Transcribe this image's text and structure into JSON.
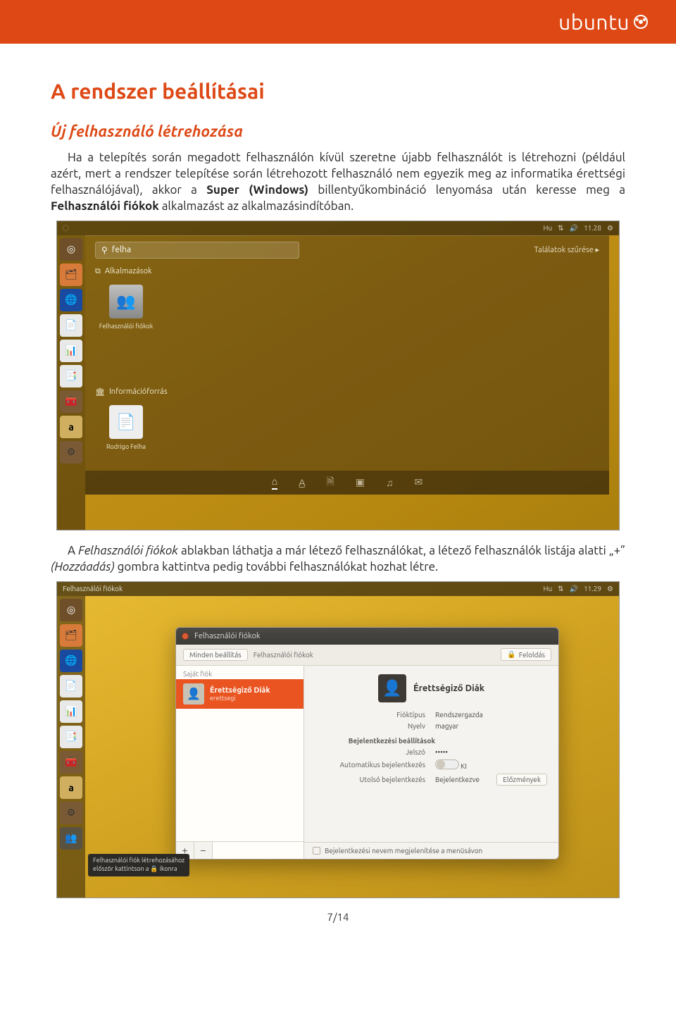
{
  "header": {
    "brand": "ubuntu"
  },
  "section_title": "A rendszer beállításai",
  "subsection_title": "Új felhasználó létrehozása",
  "para1_a": "Ha a telepítés során megadott felhasználón kívül szeretne újabb felhasználót is létrehozni (például azért, mert a rendszer telepítése során létrehozott felhasználó nem egyezik meg az informatika érettségi felhasználójával), akkor a ",
  "para1_bold1": "Super (Windows)",
  "para1_b": " billentyűkombináció lenyomása után keresse meg a ",
  "para1_bold2": "Felhasználói fiókok",
  "para1_c": " alkalmazást az alkalmazásindítóban.",
  "para2_a": "A ",
  "para2_it": "Felhasználói fiókok",
  "para2_b": " ablakban láthatja a már létező felhasználókat, a létező felhasználók listája alatti „+” ",
  "para2_it2": "(Hozzáadás)",
  "para2_c": " gombra kattintva pedig további felhasználókat hozhat létre.",
  "shot1": {
    "panel": {
      "hu": "Hu",
      "net": "⇅",
      "vol": "🔊",
      "time": "11.28",
      "gear": "⚙"
    },
    "search_value": "felha",
    "filter_label": "Találatok szűrése ▸",
    "cat_apps": "Alkalmazások",
    "tile_users": "Felhasználói fiókok",
    "cat_info": "Információforrás",
    "tile_file": "Rodrigo Felha"
  },
  "shot2": {
    "panel": {
      "title": "Felhasználói fiókok",
      "hu": "Hu",
      "net": "⇅",
      "vol": "🔊",
      "time": "11.29",
      "gear": "⚙"
    },
    "win_title": "Felhasználói fiókok",
    "crumb_all": "Minden beállítás",
    "crumb_here": "Felhasználói fiókok",
    "unlock": "Feloldás",
    "left_header": "Saját fiók",
    "user_name": "Érettségiző Diák",
    "user_sub": "erettsegi",
    "right_name": "Érettségiző Diák",
    "kv_type_k": "Fióktípus",
    "kv_type_v": "Rendszergazda",
    "kv_lang_k": "Nyelv",
    "kv_lang_v": "magyar",
    "sect_login": "Bejelentkezési beállítások",
    "kv_pw_k": "Jelszó",
    "kv_pw_v": "•••••",
    "kv_auto_k": "Automatikus bejelentkezés",
    "kv_auto_state": "KI",
    "kv_last_k": "Utolsó bejelentkezés",
    "kv_last_v": "Bejelentkezve",
    "hist_btn": "Előzmények",
    "foot_cb": "Bejelentkezési nevem megjelenítése a menüsávon",
    "tooltip_l1": "Felhasználói fiók létrehozásához",
    "tooltip_l2": "először kattintson a 🔒 ikonra"
  },
  "page_num": "7/14"
}
